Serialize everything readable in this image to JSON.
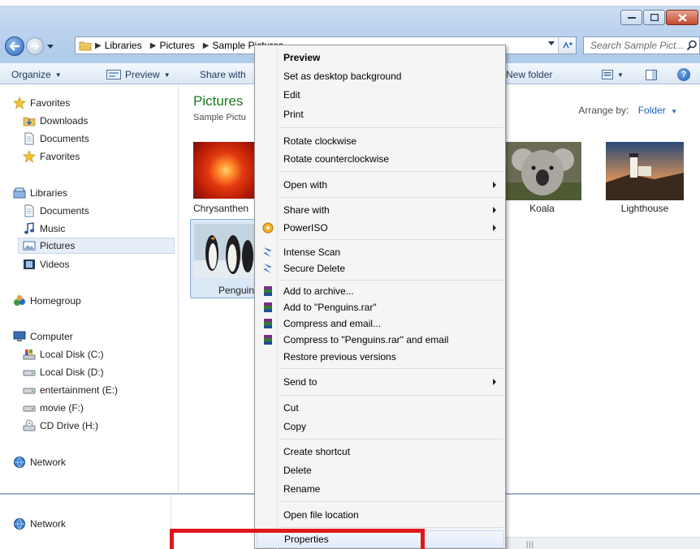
{
  "window": {
    "breadcrumb": [
      "Libraries",
      "Pictures",
      "Sample Pictures"
    ],
    "search_placeholder": "Search Sample Pict...",
    "buttons": {
      "minimize": "minimize",
      "maximize": "maximize",
      "close": "close"
    }
  },
  "toolbar": {
    "organize": "Organize",
    "preview": "Preview",
    "share_with": "Share with",
    "new_folder": "New folder"
  },
  "navpane": {
    "favorites": {
      "header": "Favorites",
      "items": [
        "Downloads",
        "Documents",
        "Favorites"
      ]
    },
    "libraries": {
      "header": "Libraries",
      "items": [
        "Documents",
        "Music",
        "Pictures",
        "Videos"
      ],
      "selected": "Pictures"
    },
    "homegroup": "Homegroup",
    "computer": {
      "header": "Computer",
      "items": [
        "Local Disk (C:)",
        "Local Disk (D:)",
        "entertainment (E:)",
        "movie (F:)",
        "CD Drive (H:)"
      ]
    },
    "network": "Network"
  },
  "content": {
    "title": "Pictures",
    "subtitle": "Sample Pictu",
    "arrange_label": "Arrange by:",
    "arrange_value": "Folder",
    "items": [
      {
        "name": "Chrysanthen",
        "selected": false
      },
      {
        "name": "Koala",
        "selected": false
      },
      {
        "name": "Lighthouse",
        "selected": false
      },
      {
        "name": "Penguins",
        "selected": true
      }
    ]
  },
  "details": {
    "network_label": "Network"
  },
  "context_menu": {
    "items": [
      {
        "label": "Preview",
        "bold": true
      },
      {
        "label": "Set as desktop background"
      },
      {
        "label": "Edit"
      },
      {
        "label": "Print"
      },
      {
        "label": "Rotate clockwise"
      },
      {
        "label": "Rotate counterclockwise"
      },
      {
        "label": "Open with",
        "submenu": true
      },
      {
        "label": "Share with",
        "submenu": true
      },
      {
        "label": "PowerISO",
        "submenu": true,
        "icon": "poweriso-icon"
      },
      {
        "label": "Intense Scan",
        "icon": "scan-icon"
      },
      {
        "label": "Secure Delete",
        "icon": "secure-delete-icon"
      },
      {
        "label": "Add to archive...",
        "icon": "winrar-icon"
      },
      {
        "label": "Add to \"Penguins.rar\"",
        "icon": "winrar-icon"
      },
      {
        "label": "Compress and email...",
        "icon": "winrar-icon"
      },
      {
        "label": "Compress to \"Penguins.rar\" and email",
        "icon": "winrar-icon"
      },
      {
        "label": "Restore previous versions"
      },
      {
        "label": "Send to",
        "submenu": true
      },
      {
        "label": "Cut"
      },
      {
        "label": "Copy"
      },
      {
        "label": "Create shortcut"
      },
      {
        "label": "Delete"
      },
      {
        "label": "Rename"
      },
      {
        "label": "Open file location"
      },
      {
        "label": "Properties",
        "highlighted": true
      }
    ]
  },
  "colors": {
    "highlight_box": "#e0161a",
    "library_title": "#1e7b1e",
    "link_blue": "#1e5fbf"
  }
}
